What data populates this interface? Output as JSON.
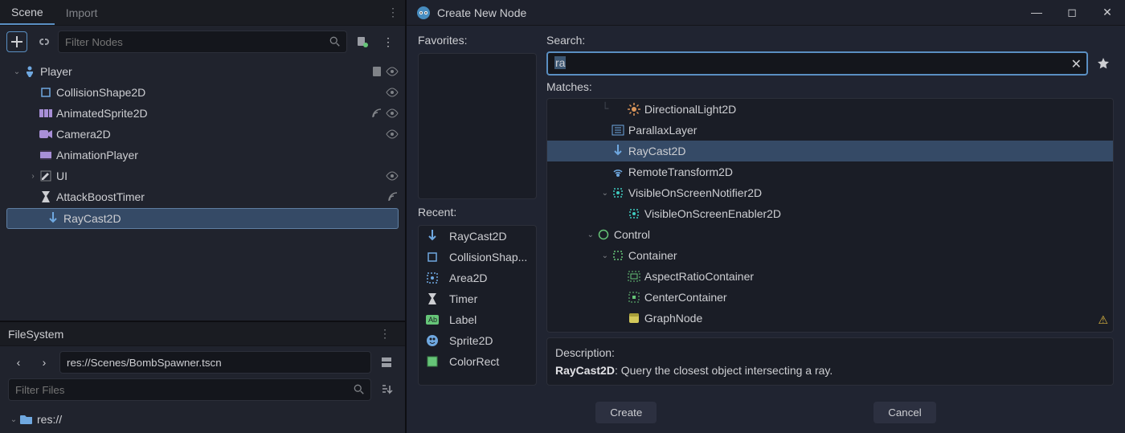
{
  "scene_panel": {
    "tabs": [
      "Scene",
      "Import"
    ],
    "active_tab": 0,
    "filter_placeholder": "Filter Nodes",
    "tree": [
      {
        "label": "Player",
        "depth": 0,
        "icon": "kinematic",
        "color": "c-blue",
        "exp": "⌄",
        "right": [
          "script",
          "eye"
        ]
      },
      {
        "label": "CollisionShape2D",
        "depth": 1,
        "icon": "square",
        "color": "c-blue",
        "right": [
          "eye"
        ]
      },
      {
        "label": "AnimatedSprite2D",
        "depth": 1,
        "icon": "frames",
        "color": "c-purple",
        "right": [
          "signal",
          "eye"
        ]
      },
      {
        "label": "Camera2D",
        "depth": 1,
        "icon": "camera",
        "color": "c-purple",
        "right": [
          "eye"
        ]
      },
      {
        "label": "AnimationPlayer",
        "depth": 1,
        "icon": "anim",
        "color": "c-purple"
      },
      {
        "label": "UI",
        "depth": 1,
        "icon": "edit",
        "color": "c-grey",
        "exp": "›",
        "right": [
          "eye"
        ]
      },
      {
        "label": "AttackBoostTimer",
        "depth": 1,
        "icon": "timer",
        "color": "c-grey",
        "right": [
          "signal"
        ]
      },
      {
        "label": "RayCast2D",
        "depth": 1,
        "icon": "ray",
        "color": "c-blue",
        "selected": true
      }
    ]
  },
  "filesystem": {
    "title": "FileSystem",
    "path": "res://Scenes/BombSpawner.tscn",
    "filter_placeholder": "Filter Files",
    "root": "res://"
  },
  "dialog": {
    "title": "Create New Node",
    "favorites_label": "Favorites:",
    "recent_label": "Recent:",
    "search_label": "Search:",
    "matches_label": "Matches:",
    "desc_label": "Description:",
    "search_value": "ra",
    "recent": [
      {
        "label": "RayCast2D",
        "icon": "ray",
        "color": "c-blue"
      },
      {
        "label": "CollisionShap...",
        "icon": "square",
        "color": "c-blue"
      },
      {
        "label": "Area2D",
        "icon": "area",
        "color": "c-blue"
      },
      {
        "label": "Timer",
        "icon": "timer",
        "color": "c-grey"
      },
      {
        "label": "Label",
        "icon": "label",
        "color": "c-green"
      },
      {
        "label": "Sprite2D",
        "icon": "sprite",
        "color": "c-blue"
      },
      {
        "label": "ColorRect",
        "icon": "colorrect",
        "color": "c-green"
      }
    ],
    "matches": [
      {
        "label": "DirectionalLight2D",
        "indent": 56,
        "guide": "└ ",
        "icon": "sun",
        "color": "c-orange"
      },
      {
        "label": "ParallaxLayer",
        "indent": 36,
        "icon": "parallax",
        "color": "c-blue"
      },
      {
        "label": "RayCast2D",
        "indent": 36,
        "guide": "",
        "icon": "ray",
        "color": "c-blue",
        "selected": true
      },
      {
        "label": "RemoteTransform2D",
        "indent": 36,
        "icon": "remote",
        "color": "c-blue"
      },
      {
        "label": "VisibleOnScreenNotifier2D",
        "indent": 36,
        "exp": "⌄",
        "icon": "notify",
        "color": "c-teal"
      },
      {
        "label": "VisibleOnScreenEnabler2D",
        "indent": 56,
        "icon": "notify",
        "color": "c-teal"
      },
      {
        "label": "Control",
        "indent": 18,
        "exp": "⌄",
        "icon": "control",
        "color": "c-green"
      },
      {
        "label": "Container",
        "indent": 36,
        "exp": "⌄",
        "icon": "container",
        "color": "c-green"
      },
      {
        "label": "AspectRatioContainer",
        "indent": 56,
        "icon": "aspect",
        "color": "c-green"
      },
      {
        "label": "CenterContainer",
        "indent": 56,
        "icon": "center",
        "color": "c-green"
      },
      {
        "label": "GraphNode",
        "indent": 56,
        "icon": "graph",
        "color": "c-yellow"
      }
    ],
    "description_node": "RayCast2D",
    "description_text": ": Query the closest object intersecting a ray.",
    "create_btn": "Create",
    "cancel_btn": "Cancel"
  }
}
